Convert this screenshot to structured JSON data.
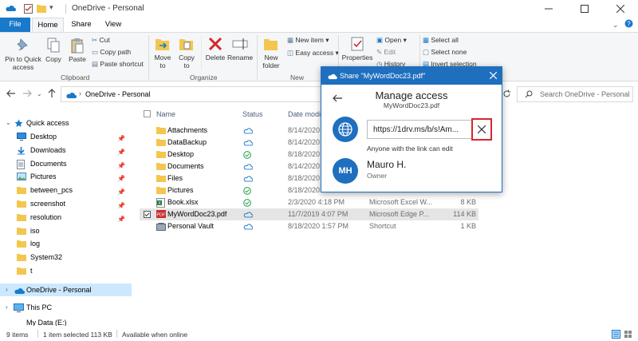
{
  "window": {
    "title": "OneDrive - Personal"
  },
  "tabs": {
    "file": "File",
    "home": "Home",
    "share": "Share",
    "view": "View"
  },
  "ribbon": {
    "pin": [
      "Pin to Quick",
      "access"
    ],
    "copy": "Copy",
    "paste": "Paste",
    "cut": "Cut",
    "copy_path": "Copy path",
    "paste_shortcut": "Paste shortcut",
    "clipboard": "Clipboard",
    "move_to": [
      "Move",
      "to"
    ],
    "copy_to": [
      "Copy",
      "to"
    ],
    "delete": "Delete",
    "rename": "Rename",
    "organize": "Organize",
    "new_folder": [
      "New",
      "folder"
    ],
    "new_item": "New item",
    "easy_access": "Easy access",
    "new": "New",
    "properties": "Properties",
    "open": "Open",
    "edit": "Edit",
    "history": "History",
    "select_all": "Select all",
    "select_none": "Select none",
    "invert_selection": "Invert selection"
  },
  "address": {
    "path_segment": "OneDrive - Personal",
    "search_placeholder": "Search OneDrive - Personal"
  },
  "nav": {
    "quick_access": "Quick access",
    "items": [
      {
        "label": "Desktop",
        "icon": "desktop-icon",
        "pinned": true
      },
      {
        "label": "Downloads",
        "icon": "downloads-icon",
        "pinned": true
      },
      {
        "label": "Documents",
        "icon": "documents-icon",
        "pinned": true
      },
      {
        "label": "Pictures",
        "icon": "pictures-icon",
        "pinned": true
      },
      {
        "label": "between_pcs",
        "icon": "folder-icon",
        "pinned": true
      },
      {
        "label": "screenshot",
        "icon": "folder-icon",
        "pinned": true
      },
      {
        "label": "resolution",
        "icon": "folder-icon",
        "pinned": true
      },
      {
        "label": "iso",
        "icon": "folder-icon",
        "pinned": false
      },
      {
        "label": "log",
        "icon": "folder-icon",
        "pinned": false
      },
      {
        "label": "System32",
        "icon": "folder-icon",
        "pinned": false
      },
      {
        "label": "t",
        "icon": "folder-icon",
        "pinned": false
      }
    ],
    "onedrive": "OneDrive - Personal",
    "this_pc": "This PC",
    "my_data": "My Data (E:)"
  },
  "columns": {
    "name": "Name",
    "status": "Status",
    "date": "Date modif"
  },
  "files": [
    {
      "name": "Attachments",
      "type": "folder",
      "status": "cloud",
      "date": "8/14/2020",
      "kind": "",
      "size": ""
    },
    {
      "name": "DataBackup",
      "type": "folder",
      "status": "cloud",
      "date": "8/14/2020",
      "kind": "",
      "size": ""
    },
    {
      "name": "Desktop",
      "type": "folder",
      "status": "ok",
      "date": "8/18/2020",
      "kind": "",
      "size": ""
    },
    {
      "name": "Documents",
      "type": "folder",
      "status": "cloud",
      "date": "8/14/2020",
      "kind": "",
      "size": ""
    },
    {
      "name": "Files",
      "type": "folder",
      "status": "cloud",
      "date": "8/18/2020",
      "kind": "",
      "size": ""
    },
    {
      "name": "Pictures",
      "type": "folder",
      "status": "ok",
      "date": "8/18/2020",
      "kind": "",
      "size": ""
    },
    {
      "name": "Book.xlsx",
      "type": "excel",
      "status": "ok",
      "date": "2/3/2020 4:18 PM",
      "kind": "Microsoft Excel W...",
      "size": "8 KB"
    },
    {
      "name": "MyWordDoc23.pdf",
      "type": "pdf",
      "status": "cloud",
      "date": "11/7/2019 4:07 PM",
      "kind": "Microsoft Edge P...",
      "size": "114 KB"
    },
    {
      "name": "Personal Vault",
      "type": "vault",
      "status": "cloud",
      "date": "8/18/2020 1:57 PM",
      "kind": "Shortcut",
      "size": "1 KB"
    }
  ],
  "status_bar": {
    "items": "9 items",
    "selected": "1 item selected  113 KB",
    "availability": "Available when online"
  },
  "dialog": {
    "title": "Share \"MyWordDoc23.pdf\"",
    "heading": "Manage access",
    "filename": "MyWordDoc23.pdf",
    "link": "https://1drv.ms/b/s!Am...",
    "link_note": "Anyone with the link can edit",
    "user_initials": "MH",
    "user_name": "Mauro H.",
    "user_role": "Owner"
  },
  "colors": {
    "accent": "#1979ca",
    "dialog_header": "#1f6fbf",
    "highlight": "#d6262d",
    "status_ok": "#2ea44f",
    "folder": "#f3c74f"
  }
}
